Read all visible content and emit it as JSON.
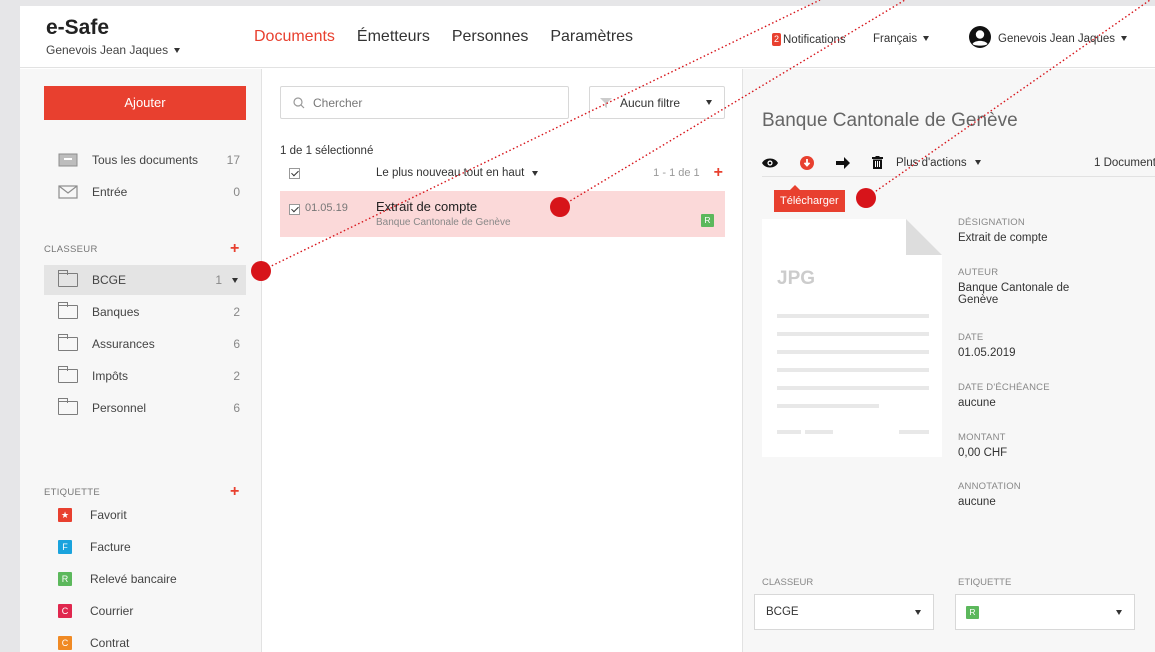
{
  "header": {
    "brand": "e-Safe",
    "brand_user": "Genevois Jean Jaques",
    "nav": {
      "documents": "Documents",
      "emetteurs": "Émetteurs",
      "personnes": "Personnes",
      "parametres": "Paramètres"
    },
    "notifications_count": "2",
    "notifications_label": "Notifications",
    "language": "Français",
    "user_name": "Genevois Jean Jaques"
  },
  "sidebar": {
    "add_label": "Ajouter",
    "all_docs": {
      "label": "Tous les documents",
      "count": "17"
    },
    "inbox": {
      "label": "Entrée",
      "count": "0"
    },
    "classeur_title": "CLASSEUR",
    "folders": [
      {
        "label": "BCGE",
        "count": "1"
      },
      {
        "label": "Banques",
        "count": "2"
      },
      {
        "label": "Assurances",
        "count": "6"
      },
      {
        "label": "Impôts",
        "count": "2"
      },
      {
        "label": "Personnel",
        "count": "6"
      }
    ],
    "etiquette_title": "ETIQUETTE",
    "tags": [
      {
        "letter": "★",
        "label": "Favorit",
        "color": "#e8402f"
      },
      {
        "letter": "F",
        "label": "Facture",
        "color": "#1aa3dd"
      },
      {
        "letter": "R",
        "label": "Relevé bancaire",
        "color": "#5cb85c"
      },
      {
        "letter": "C",
        "label": "Courrier",
        "color": "#e0274e"
      },
      {
        "letter": "C",
        "label": "Contrat",
        "color": "#f08a24"
      }
    ]
  },
  "list": {
    "search_placeholder": "Chercher",
    "filter_label": "Aucun filtre",
    "selected_count": "1 de 1 sélectionné",
    "sort_label": "Le plus nouveau tout en haut",
    "pagination": "1 - 1 de 1",
    "documents": [
      {
        "date": "01.05.19",
        "title": "Extrait de compte",
        "issuer": "Banque Cantonale de Genève",
        "tag": "R"
      }
    ]
  },
  "detail": {
    "title": "Banque Cantonale de Genève",
    "more_actions": "Plus d'actions",
    "doc_count": "1 Document",
    "tooltip": "Télécharger",
    "file_type": "JPG",
    "fields": [
      {
        "key": "DÉSIGNATION",
        "value": "Extrait de compte"
      },
      {
        "key": "AUTEUR",
        "value": "Banque Cantonale de Genève"
      },
      {
        "key": "DATE",
        "value": "01.05.2019"
      },
      {
        "key": "DATE D'ÉCHÉANCE",
        "value": "aucune"
      },
      {
        "key": "MONTANT",
        "value": "0,00 CHF"
      },
      {
        "key": "ANNOTATION",
        "value": "aucune"
      }
    ],
    "classeur_label": "CLASSEUR",
    "classeur_value": "BCGE",
    "etiquette_label": "ETIQUETTE",
    "etiquette_value": "R"
  },
  "colors": {
    "accent": "#e8402f",
    "selected_row": "#fbd9d9",
    "tag_green": "#5cb85c"
  }
}
